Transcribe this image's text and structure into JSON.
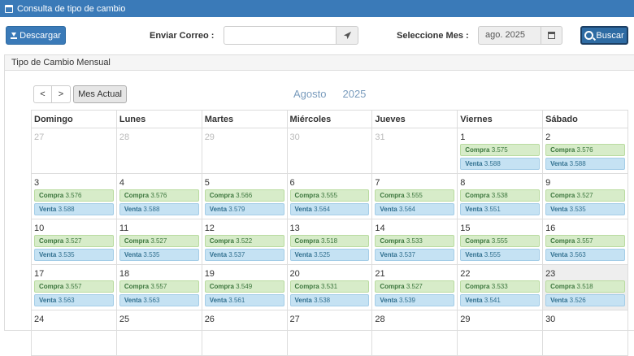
{
  "topbar": {
    "title": "Consulta de tipo de cambio",
    "icon": "calendar-icon"
  },
  "toolbar": {
    "download_label": "Descargar",
    "email_label": "Enviar Correo :",
    "email_value": "",
    "month_label": "Seleccione Mes :",
    "month_value": "ago. 2025",
    "search_label": "Buscar"
  },
  "panel": {
    "title": "Tipo de Cambio Mensual"
  },
  "calendar": {
    "prev": "<",
    "next": ">",
    "today": "Mes Actual",
    "month": "Agosto",
    "year": "2025",
    "weekdays": [
      "Domingo",
      "Lunes",
      "Martes",
      "Miércoles",
      "Jueves",
      "Viernes",
      "Sábado"
    ],
    "compra_label": "Compra",
    "venta_label": "Venta",
    "weeks": [
      [
        {
          "day": "27",
          "other": true
        },
        {
          "day": "28",
          "other": true
        },
        {
          "day": "29",
          "other": true
        },
        {
          "day": "30",
          "other": true
        },
        {
          "day": "31",
          "other": true
        },
        {
          "day": "1",
          "compra": "3.575",
          "venta": "3.588"
        },
        {
          "day": "2",
          "compra": "3.576",
          "venta": "3.588"
        }
      ],
      [
        {
          "day": "3",
          "compra": "3.576",
          "venta": "3.588"
        },
        {
          "day": "4",
          "compra": "3.576",
          "venta": "3.588"
        },
        {
          "day": "5",
          "compra": "3.566",
          "venta": "3.579"
        },
        {
          "day": "6",
          "compra": "3.555",
          "venta": "3.564"
        },
        {
          "day": "7",
          "compra": "3.555",
          "venta": "3.564"
        },
        {
          "day": "8",
          "compra": "3.538",
          "venta": "3.551"
        },
        {
          "day": "9",
          "compra": "3.527",
          "venta": "3.535"
        }
      ],
      [
        {
          "day": "10",
          "compra": "3.527",
          "venta": "3.535"
        },
        {
          "day": "11",
          "compra": "3.527",
          "venta": "3.535"
        },
        {
          "day": "12",
          "compra": "3.522",
          "venta": "3.537"
        },
        {
          "day": "13",
          "compra": "3.518",
          "venta": "3.525"
        },
        {
          "day": "14",
          "compra": "3.533",
          "venta": "3.537"
        },
        {
          "day": "15",
          "compra": "3.555",
          "venta": "3.555"
        },
        {
          "day": "16",
          "compra": "3.557",
          "venta": "3.563"
        }
      ],
      [
        {
          "day": "17",
          "compra": "3.557",
          "venta": "3.563"
        },
        {
          "day": "18",
          "compra": "3.557",
          "venta": "3.563"
        },
        {
          "day": "19",
          "compra": "3.549",
          "venta": "3.561"
        },
        {
          "day": "20",
          "compra": "3.531",
          "venta": "3.538"
        },
        {
          "day": "21",
          "compra": "3.527",
          "venta": "3.539"
        },
        {
          "day": "22",
          "compra": "3.533",
          "venta": "3.541"
        },
        {
          "day": "23",
          "compra": "3.518",
          "venta": "3.526",
          "today": true
        }
      ],
      [
        {
          "day": "24"
        },
        {
          "day": "25"
        },
        {
          "day": "26"
        },
        {
          "day": "27"
        },
        {
          "day": "28"
        },
        {
          "day": "29"
        },
        {
          "day": "30"
        }
      ]
    ]
  }
}
